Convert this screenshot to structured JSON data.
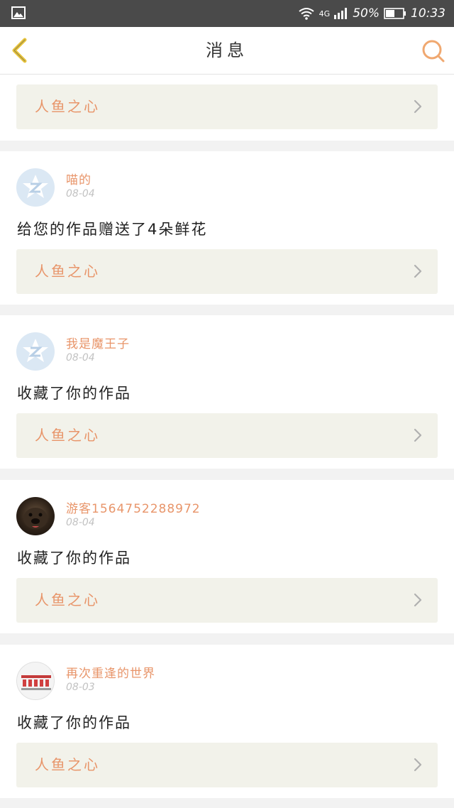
{
  "status": {
    "network": "4G",
    "battery": "50%",
    "time": "10:33"
  },
  "header": {
    "title": "消息"
  },
  "top_work": {
    "title": "人鱼之心"
  },
  "messages": [
    {
      "user": "喵的",
      "date": "08-04",
      "action": "给您的作品赠送了4朵鲜花",
      "work": "人鱼之心"
    },
    {
      "user": "我是魔王子",
      "date": "08-04",
      "action": "收藏了你的作品",
      "work": "人鱼之心"
    },
    {
      "user": "游客1564752288972",
      "date": "08-04",
      "action": "收藏了你的作品",
      "work": "人鱼之心"
    },
    {
      "user": "再次重逢的世界",
      "date": "08-03",
      "action": "收藏了你的作品",
      "work": "人鱼之心"
    }
  ],
  "colors": {
    "accent": "#e8956a",
    "back_arrow": "#e8c43a",
    "link_bg": "#f2f2ea"
  },
  "icons": {
    "back": "back-arrow-icon",
    "search": "search-icon",
    "chevron": "chevron-right-icon"
  }
}
